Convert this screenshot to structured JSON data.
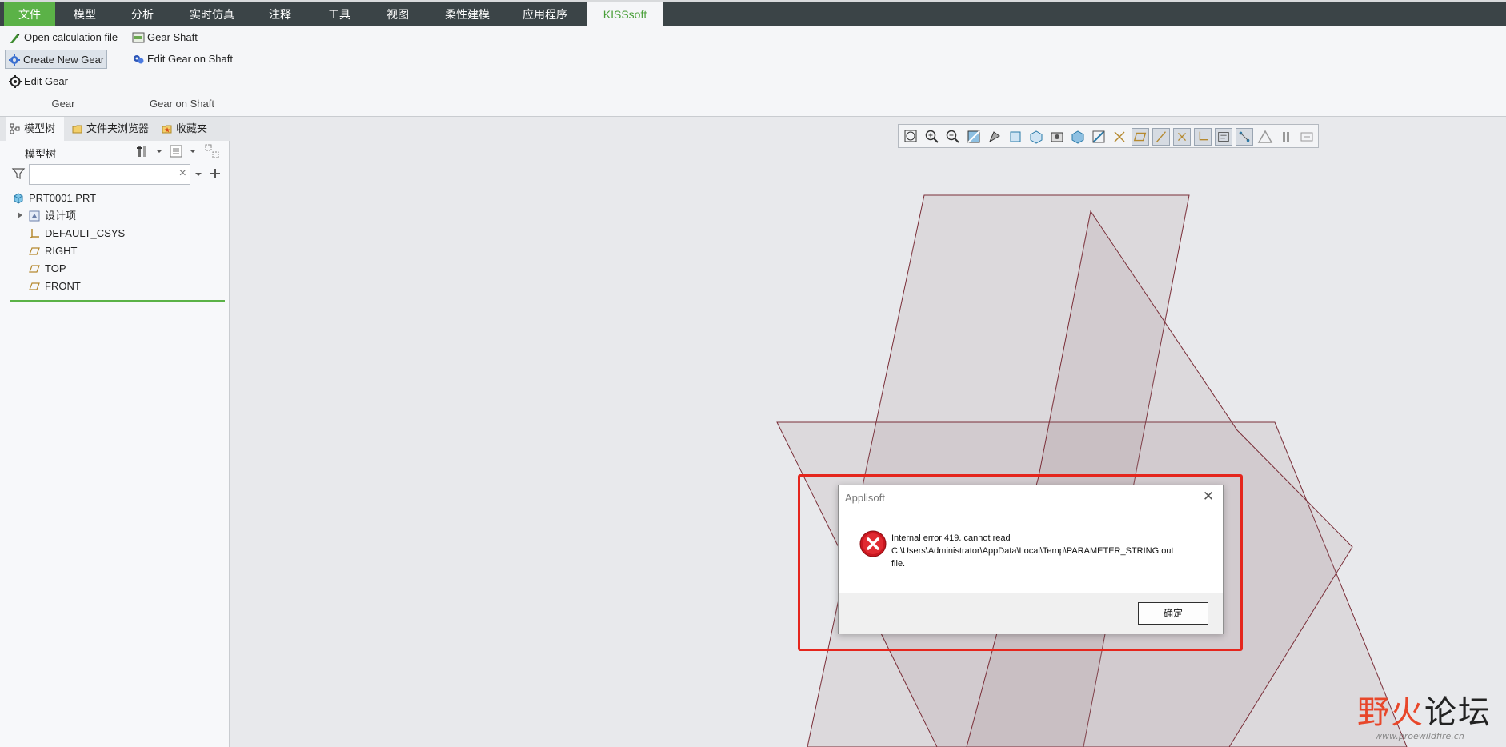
{
  "ribbon_tabs": [
    "文件",
    "模型",
    "分析",
    "实时仿真",
    "注释",
    "工具",
    "视图",
    "柔性建模",
    "应用程序",
    "KISSsoft"
  ],
  "ribbon": {
    "gear_group": {
      "label": "Gear",
      "buttons": [
        "Open calculation file",
        "Create New Gear",
        "Edit Gear"
      ]
    },
    "shaft_group": {
      "label": "Gear on Shaft",
      "buttons": [
        "Gear Shaft",
        "Edit Gear on Shaft"
      ]
    }
  },
  "left_tabs": [
    "模型树",
    "文件夹浏览器",
    "收藏夹"
  ],
  "tree_header": "模型树",
  "filter": {
    "value": "",
    "clear": "×"
  },
  "tree_items": [
    "PRT0001.PRT",
    "设计项",
    "DEFAULT_CSYS",
    "RIGHT",
    "TOP",
    "FRONT"
  ],
  "dialog": {
    "title": "Applisoft",
    "close": "✕",
    "message_line1": "Internal error 419.  cannot read",
    "message_line2": "C:\\Users\\Administrator\\AppData\\Local\\Temp\\PARAMETER_STRING.out",
    "message_line3": "file.",
    "ok_label": "确定"
  },
  "watermark": {
    "text_a": "野火",
    "text_b": "论坛",
    "url": "www.proewildfire.cn"
  },
  "colors": {
    "tab_bar": "#3b4447",
    "file_tab": "#5bb247",
    "active_tab_text": "#4aa03a",
    "highlight_red": "#e5261d",
    "plane_edge": "#7a2e38"
  }
}
